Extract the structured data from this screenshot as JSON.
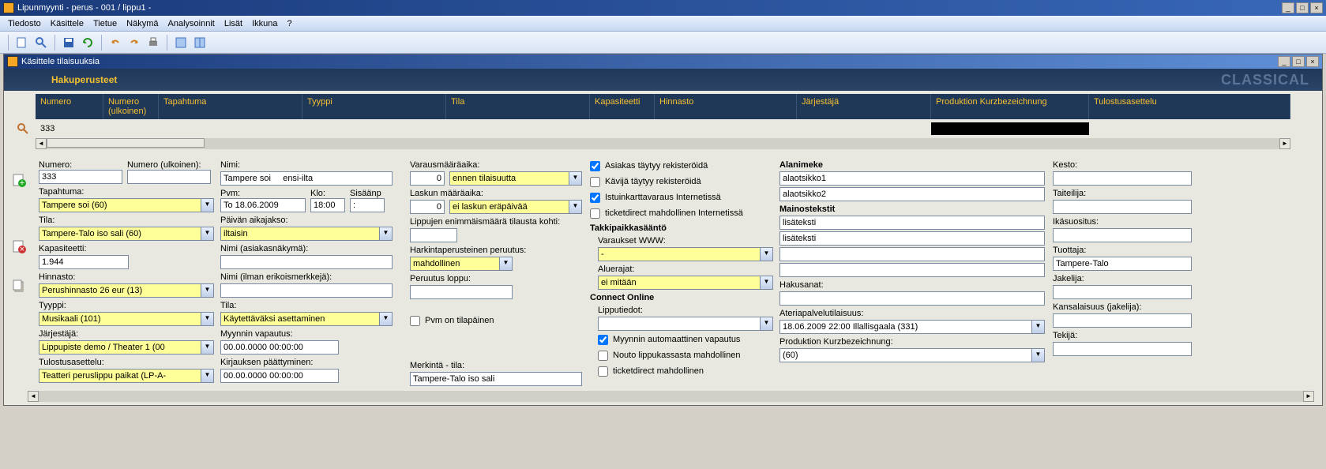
{
  "window": {
    "title": "Lipunmyynti - perus  - 001 / lippu1 -",
    "sub_title": "Käsittele tilaisuuksia"
  },
  "menu": [
    "Tiedosto",
    "Käsittele",
    "Tietue",
    "Näkymä",
    "Analysoinnit",
    "Lisät",
    "Ikkuna",
    "?"
  ],
  "header": {
    "search_label": "Hakuperusteet",
    "brand": "CLASSICAL"
  },
  "filter_cols": {
    "numero": "Numero",
    "numero_ulk": "Numero (ulkoinen)",
    "tapahtuma": "Tapahtuma",
    "tyyppi": "Tyyppi",
    "tila": "Tila",
    "kapasiteetti": "Kapasiteetti",
    "hinnasto": "Hinnasto",
    "jarjestaja": "Järjestäjä",
    "produktion": "Produktion Kurzbezeichnung",
    "tulostus": "Tulostusasettelu"
  },
  "filter_vals": {
    "numero": "333"
  },
  "c1": {
    "numero_l": "Numero:",
    "numero_v": "333",
    "numero_ulk_l": "Numero (ulkoinen):",
    "numero_ulk_v": "",
    "tapahtuma_l": "Tapahtuma:",
    "tapahtuma_v": "Tampere soi (60)",
    "tila_l": "Tila:",
    "tila_v": "Tampere-Talo iso sali (60)",
    "kapasiteetti_l": "Kapasiteetti:",
    "kapasiteetti_v": "1.944",
    "hinnasto_l": "Hinnasto:",
    "hinnasto_v": "Perushinnasto 26 eur (13)",
    "tyyppi_l": "Tyyppi:",
    "tyyppi_v": "Musikaali (101)",
    "jarjestaja_l": "Järjestäjä:",
    "jarjestaja_v": "Lippupiste demo / Theater 1 (00",
    "tulostus_l": "Tulostusasettelu:",
    "tulostus_v": "Teatteri peruslippu paikat (LP-A-"
  },
  "c2": {
    "nimi_l": "Nimi:",
    "nimi_v": "Tampere soi     ensi-ilta",
    "pvm_l": "Pvm:",
    "pvm_v": "To 18.06.2009",
    "klo_l": "Klo:",
    "klo_v": "18:00",
    "sisaan_l": "Sisäänp",
    "sisaan_v": ":",
    "paivan_l": "Päivän aikajakso:",
    "paivan_v": "iltaisin",
    "nimi_asiakas_l": "Nimi (asiakasnäkymä):",
    "nimi_asiakas_v": "",
    "nimi_ilman_l": "Nimi (ilman erikoismerkkejä):",
    "nimi_ilman_v": "",
    "tila_l": "Tila:",
    "tila_v": "Käytettäväksi asettaminen",
    "myynti_l": "Myynnin vapautus:",
    "myynti_v": "00.00.0000 00:00:00",
    "kirjauksen_l": "Kirjauksen päättyminen:",
    "kirjauksen_v": "00.00.0000 00:00:00"
  },
  "c3": {
    "varaus_l": "Varausmääräaika:",
    "varaus_v": "0",
    "varaus_sel": "ennen tilaisuutta",
    "laskun_l": "Laskun määräaika:",
    "laskun_v": "0",
    "laskun_sel": "ei laskun eräpäivää",
    "lippujen_l": "Lippujen enimmäismäärä tilausta kohti:",
    "lippujen_v": "",
    "harkinta_l": "Harkintaperusteinen peruutus:",
    "harkinta_v": "mahdollinen",
    "peruutus_l": "Peruutus loppu:",
    "peruutus_v": "",
    "pvm_tilap_l": "Pvm on tilapäinen",
    "merkinta_l": "Merkintä - tila:",
    "merkinta_v": "Tampere-Talo iso sali"
  },
  "c4": {
    "asiakas": "Asiakas täytyy rekisteröidä",
    "kavija": "Kävijä täytyy rekisteröidä",
    "istuinkartta": "Istuinkarttavaraus Internetissä",
    "ticketdirect_int": "ticketdirect mahdollinen Internetissä",
    "takkipaikka_hdr": "Takkipaikkasääntö",
    "varaukset_l": "Varaukset WWW:",
    "varaukset_v": "-",
    "aluerajat_l": "Aluerajat:",
    "aluerajat_v": "ei mitään",
    "connect_hdr": "Connect Online",
    "lipputiedot_l": "Lipputiedot:",
    "lipputiedot_v": "",
    "myynti_auto": "Myynnin automaattinen vapautus",
    "nouto": "Nouto lippukassasta mahdollinen",
    "ticketdirect": "ticketdirect mahdollinen"
  },
  "c5": {
    "alanimeke_hdr": "Alanimeke",
    "alaotsikko1": "alaotsikko1",
    "alaotsikko2": "alaotsikko2",
    "mainostekstit_hdr": "Mainostekstit",
    "lisateksti1": "lisäteksti",
    "lisateksti2": "lisäteksti",
    "hakusanat_l": "Hakusanat:",
    "hakusanat_v": "",
    "ateria_l": "Ateriapalvelutilaisuus:",
    "ateria_v": "18.06.2009  22:00  Illallisgaala  (331)",
    "produktion_l": "Produktion Kurzbezeichnung:",
    "produktion_v": "  (60)"
  },
  "c6": {
    "kesto_l": "Kesto:",
    "kesto_v": "",
    "taiteilija_l": "Taiteilija:",
    "taiteilija_v": "",
    "ikasuositus_l": "Ikäsuositus:",
    "ikasuositus_v": "",
    "tuottaja_l": "Tuottaja:",
    "tuottaja_v": "Tampere-Talo",
    "jakelija_l": "Jakelija:",
    "jakelija_v": "",
    "kansalaisuus_l": "Kansalaisuus (jakelija):",
    "kansalaisuus_v": "",
    "tekija_l": "Tekijä:",
    "tekija_v": ""
  }
}
